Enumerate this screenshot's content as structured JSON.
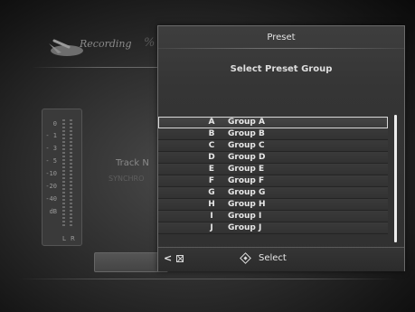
{
  "background": {
    "app_title": "Recording",
    "partial_mark": "%",
    "meter": {
      "db_scale": [
        "0",
        "- 1",
        "- 3",
        "- 5",
        "-10",
        "-20",
        "-40",
        "dB"
      ],
      "channels": [
        "L",
        "R"
      ]
    },
    "track_label": "Track N",
    "sync_label": "SYNCHRO"
  },
  "dialog": {
    "title": "Preset",
    "subtitle": "Select Preset Group",
    "groups": [
      {
        "letter": "A",
        "name": "Group A"
      },
      {
        "letter": "B",
        "name": "Group B"
      },
      {
        "letter": "C",
        "name": "Group C"
      },
      {
        "letter": "D",
        "name": "Group D"
      },
      {
        "letter": "E",
        "name": "Group E"
      },
      {
        "letter": "F",
        "name": "Group F"
      },
      {
        "letter": "G",
        "name": "Group G"
      },
      {
        "letter": "H",
        "name": "Group H"
      },
      {
        "letter": "I",
        "name": "Group I"
      },
      {
        "letter": "J",
        "name": "Group J"
      }
    ],
    "selected_index": 0,
    "footer": {
      "back_glyph": "<",
      "select_label": "Select"
    }
  },
  "icons": {
    "back": "back-arrow-icon",
    "return": "return-box-icon",
    "select": "diamond-select-icon",
    "logo": "recording-logo-icon"
  }
}
